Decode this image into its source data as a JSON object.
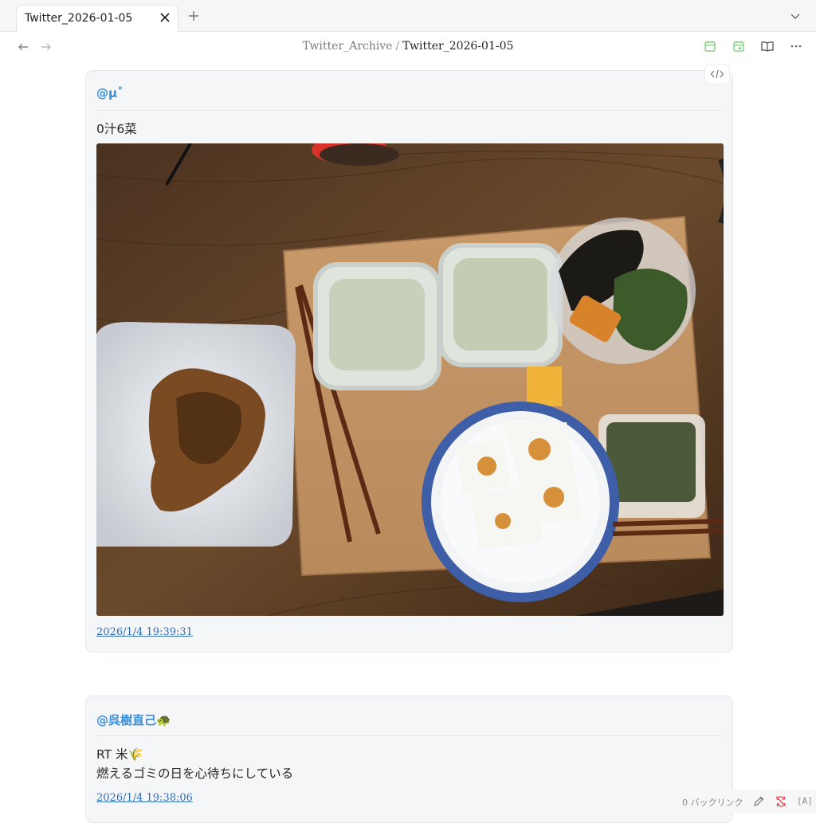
{
  "tab": {
    "title": "Twitter_2026-01-05"
  },
  "breadcrumb": {
    "parent": "Twitter_Archive",
    "separator": "/",
    "current": "Twitter_2026-01-05"
  },
  "posts": [
    {
      "author": "@μ˚",
      "text": "0汁6菜",
      "timestamp": "2026/1/4 19:39:31",
      "image": "photo of a meal on a wooden tray"
    },
    {
      "author": "@呉樹直己🐢",
      "text": "RT 米🌾\n燃えるゴミの日を心待ちにしている",
      "timestamp": "2026/1/4 19:38:06"
    }
  ],
  "status": {
    "backlinks": "0 バックリンク",
    "lang": "[A]"
  },
  "colors": {
    "author": "#3b8fd9",
    "link": "#2f6db3",
    "calendar_icon": "#7cc77a",
    "sync_error": "#e0454f"
  },
  "icons": [
    "close-icon",
    "plus-icon",
    "chevron-down-icon",
    "arrow-left-icon",
    "arrow-right-icon",
    "calendar-icon",
    "calendar-next-icon",
    "book-open-icon",
    "more-icon",
    "code-icon",
    "pencil-icon",
    "sync-off-icon"
  ]
}
